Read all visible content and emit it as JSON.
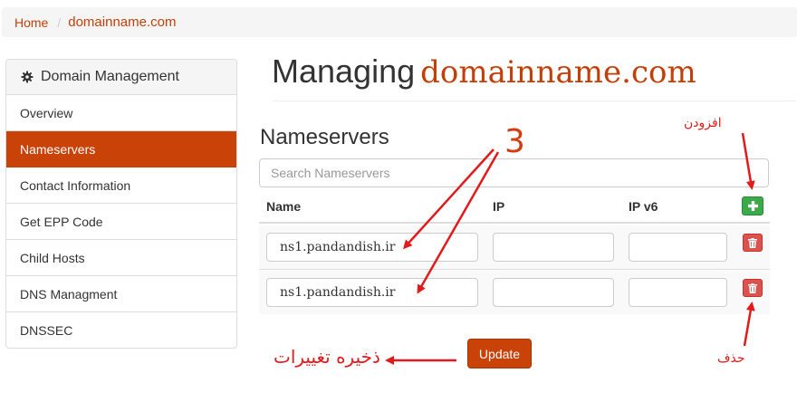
{
  "breadcrumb": {
    "home": "Home",
    "separator": "/",
    "current": "domainname.com"
  },
  "sidebar": {
    "heading": "Domain Management",
    "heading_icon": "gear-icon",
    "items": [
      {
        "label": "Overview",
        "active": false
      },
      {
        "label": "Nameservers",
        "active": true
      },
      {
        "label": "Contact Information",
        "active": false
      },
      {
        "label": "Get EPP Code",
        "active": false
      },
      {
        "label": "Child Hosts",
        "active": false
      },
      {
        "label": "DNS Managment",
        "active": false
      },
      {
        "label": "DNSSEC",
        "active": false
      }
    ]
  },
  "page": {
    "title_prefix": "Managing",
    "title_domain": "domainname.com"
  },
  "nameservers": {
    "heading": "Nameservers",
    "search_placeholder": "Search Nameservers",
    "columns": {
      "name": "Name",
      "ip": "IP",
      "ipv6": "IP v6"
    },
    "rows": [
      {
        "name": "ns1.pandandish.ir",
        "ip": "",
        "ipv6": ""
      },
      {
        "name": "ns1.pandandish.ir",
        "ip": "",
        "ipv6": ""
      }
    ],
    "add_icon": "plus-icon",
    "delete_icon": "trash-icon",
    "update_label": "Update"
  },
  "annotations": {
    "count": "3",
    "add": "افزودن",
    "save": "ذخیره تغییرات",
    "delete": "حذف",
    "color": "#e41a1a"
  },
  "colors": {
    "accent": "#c94208",
    "add_green": "#3ca94b",
    "delete_red": "#d9534f"
  }
}
